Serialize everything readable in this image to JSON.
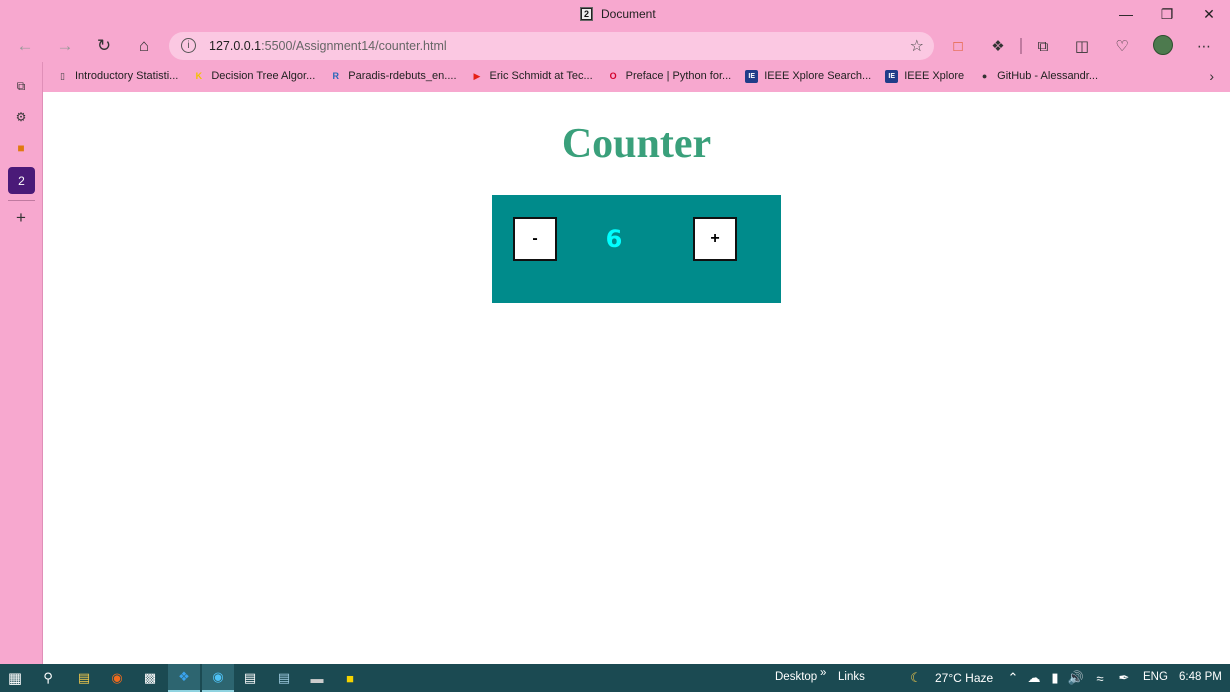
{
  "window": {
    "title": "Document",
    "tab_favicon_glyph": "2",
    "controls": [
      "minimize-icon",
      "restore-icon",
      "close-icon"
    ]
  },
  "navigation": {
    "url_host": "127.0.0.1",
    "url_path": ":5500/Assignment14/counter.html",
    "info_glyph": "i"
  },
  "bookmarks": [
    {
      "label": "Introductory Statisti...",
      "icon": "page-icon",
      "glyph": "▯",
      "color": "#444"
    },
    {
      "label": "Decision Tree Algor...",
      "icon": "k-logo-icon",
      "glyph": "K",
      "color": "#f2c200"
    },
    {
      "label": "Paradis-rdebuts_en....",
      "icon": "r-logo-icon",
      "glyph": "R",
      "color": "#2767b9"
    },
    {
      "label": "Eric Schmidt at Tec...",
      "icon": "youtube-icon",
      "glyph": "▶",
      "color": "#e62117"
    },
    {
      "label": "Preface | Python for...",
      "icon": "oreilly-icon",
      "glyph": "O",
      "color": "#d3002d"
    },
    {
      "label": "IEEE Xplore Search...",
      "icon": "ieee-icon",
      "glyph": "IE",
      "color": "#1f3c88"
    },
    {
      "label": "IEEE Xplore",
      "icon": "ieee-icon",
      "glyph": "IE",
      "color": "#1f3c88"
    },
    {
      "label": "GitHub - Alessandr...",
      "icon": "github-icon",
      "glyph": "●",
      "color": "#333"
    }
  ],
  "page": {
    "heading": "Counter",
    "decrement_label": "-",
    "increment_label": "+",
    "count": "6"
  },
  "taskbar": {
    "toolbar_desktop": "Desktop",
    "toolbar_chevron": "»",
    "toolbar_links": "Links",
    "weather": "27°C Haze",
    "language": "ENG",
    "time": "6:48 PM"
  },
  "colors": {
    "browser_chrome": "#f7a8cf",
    "heading": "#3aa07b",
    "panel": "#008b8b",
    "count": "#00ffff",
    "taskbar": "#1b4a52"
  }
}
